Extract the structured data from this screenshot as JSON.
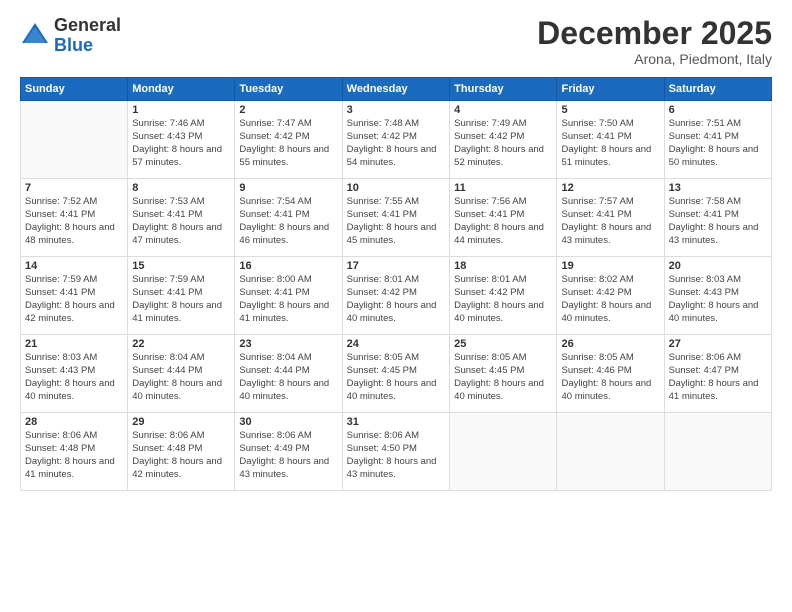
{
  "header": {
    "logo_general": "General",
    "logo_blue": "Blue",
    "month_title": "December 2025",
    "location": "Arona, Piedmont, Italy"
  },
  "weekdays": [
    "Sunday",
    "Monday",
    "Tuesday",
    "Wednesday",
    "Thursday",
    "Friday",
    "Saturday"
  ],
  "weeks": [
    [
      {
        "day": "",
        "sunrise": "",
        "sunset": "",
        "daylight": ""
      },
      {
        "day": "1",
        "sunrise": "7:46 AM",
        "sunset": "4:43 PM",
        "daylight": "8 hours and 57 minutes."
      },
      {
        "day": "2",
        "sunrise": "7:47 AM",
        "sunset": "4:42 PM",
        "daylight": "8 hours and 55 minutes."
      },
      {
        "day": "3",
        "sunrise": "7:48 AM",
        "sunset": "4:42 PM",
        "daylight": "8 hours and 54 minutes."
      },
      {
        "day": "4",
        "sunrise": "7:49 AM",
        "sunset": "4:42 PM",
        "daylight": "8 hours and 52 minutes."
      },
      {
        "day": "5",
        "sunrise": "7:50 AM",
        "sunset": "4:41 PM",
        "daylight": "8 hours and 51 minutes."
      },
      {
        "day": "6",
        "sunrise": "7:51 AM",
        "sunset": "4:41 PM",
        "daylight": "8 hours and 50 minutes."
      }
    ],
    [
      {
        "day": "7",
        "sunrise": "7:52 AM",
        "sunset": "4:41 PM",
        "daylight": "8 hours and 48 minutes."
      },
      {
        "day": "8",
        "sunrise": "7:53 AM",
        "sunset": "4:41 PM",
        "daylight": "8 hours and 47 minutes."
      },
      {
        "day": "9",
        "sunrise": "7:54 AM",
        "sunset": "4:41 PM",
        "daylight": "8 hours and 46 minutes."
      },
      {
        "day": "10",
        "sunrise": "7:55 AM",
        "sunset": "4:41 PM",
        "daylight": "8 hours and 45 minutes."
      },
      {
        "day": "11",
        "sunrise": "7:56 AM",
        "sunset": "4:41 PM",
        "daylight": "8 hours and 44 minutes."
      },
      {
        "day": "12",
        "sunrise": "7:57 AM",
        "sunset": "4:41 PM",
        "daylight": "8 hours and 43 minutes."
      },
      {
        "day": "13",
        "sunrise": "7:58 AM",
        "sunset": "4:41 PM",
        "daylight": "8 hours and 43 minutes."
      }
    ],
    [
      {
        "day": "14",
        "sunrise": "7:59 AM",
        "sunset": "4:41 PM",
        "daylight": "8 hours and 42 minutes."
      },
      {
        "day": "15",
        "sunrise": "7:59 AM",
        "sunset": "4:41 PM",
        "daylight": "8 hours and 41 minutes."
      },
      {
        "day": "16",
        "sunrise": "8:00 AM",
        "sunset": "4:41 PM",
        "daylight": "8 hours and 41 minutes."
      },
      {
        "day": "17",
        "sunrise": "8:01 AM",
        "sunset": "4:42 PM",
        "daylight": "8 hours and 40 minutes."
      },
      {
        "day": "18",
        "sunrise": "8:01 AM",
        "sunset": "4:42 PM",
        "daylight": "8 hours and 40 minutes."
      },
      {
        "day": "19",
        "sunrise": "8:02 AM",
        "sunset": "4:42 PM",
        "daylight": "8 hours and 40 minutes."
      },
      {
        "day": "20",
        "sunrise": "8:03 AM",
        "sunset": "4:43 PM",
        "daylight": "8 hours and 40 minutes."
      }
    ],
    [
      {
        "day": "21",
        "sunrise": "8:03 AM",
        "sunset": "4:43 PM",
        "daylight": "8 hours and 40 minutes."
      },
      {
        "day": "22",
        "sunrise": "8:04 AM",
        "sunset": "4:44 PM",
        "daylight": "8 hours and 40 minutes."
      },
      {
        "day": "23",
        "sunrise": "8:04 AM",
        "sunset": "4:44 PM",
        "daylight": "8 hours and 40 minutes."
      },
      {
        "day": "24",
        "sunrise": "8:05 AM",
        "sunset": "4:45 PM",
        "daylight": "8 hours and 40 minutes."
      },
      {
        "day": "25",
        "sunrise": "8:05 AM",
        "sunset": "4:45 PM",
        "daylight": "8 hours and 40 minutes."
      },
      {
        "day": "26",
        "sunrise": "8:05 AM",
        "sunset": "4:46 PM",
        "daylight": "8 hours and 40 minutes."
      },
      {
        "day": "27",
        "sunrise": "8:06 AM",
        "sunset": "4:47 PM",
        "daylight": "8 hours and 41 minutes."
      }
    ],
    [
      {
        "day": "28",
        "sunrise": "8:06 AM",
        "sunset": "4:48 PM",
        "daylight": "8 hours and 41 minutes."
      },
      {
        "day": "29",
        "sunrise": "8:06 AM",
        "sunset": "4:48 PM",
        "daylight": "8 hours and 42 minutes."
      },
      {
        "day": "30",
        "sunrise": "8:06 AM",
        "sunset": "4:49 PM",
        "daylight": "8 hours and 43 minutes."
      },
      {
        "day": "31",
        "sunrise": "8:06 AM",
        "sunset": "4:50 PM",
        "daylight": "8 hours and 43 minutes."
      },
      {
        "day": "",
        "sunrise": "",
        "sunset": "",
        "daylight": ""
      },
      {
        "day": "",
        "sunrise": "",
        "sunset": "",
        "daylight": ""
      },
      {
        "day": "",
        "sunrise": "",
        "sunset": "",
        "daylight": ""
      }
    ]
  ]
}
